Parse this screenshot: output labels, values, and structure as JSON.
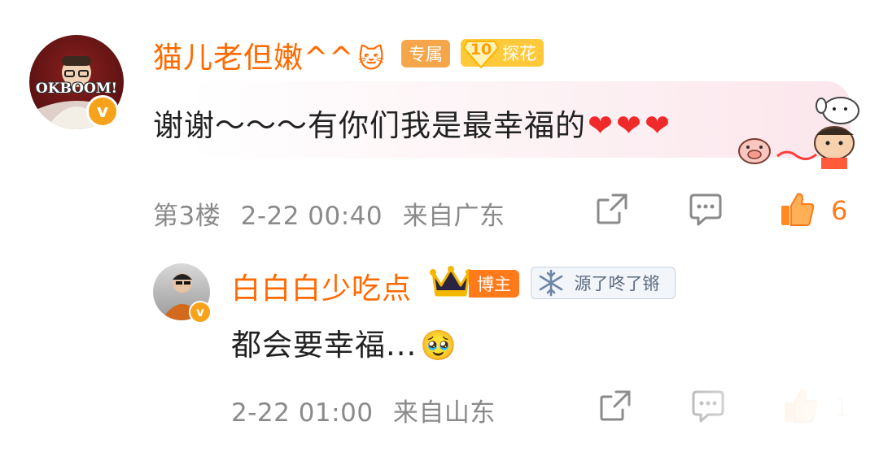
{
  "comment1": {
    "username": "猫儿老但嫩^^",
    "username_emoji": "🐱",
    "badge_exclusive": "专属",
    "badge_level": "10",
    "badge_tanhua": "探花",
    "text": "谢谢～～～有你们我是最幸福的",
    "hearts": "❤❤❤",
    "floor": "第3楼",
    "time": "2-22 00:40",
    "location": "来自广东",
    "likes": "6",
    "avatar_label": "OKBOOM!"
  },
  "reply": {
    "username": "白白白少吃点",
    "badge_host": "博主",
    "badge_fans": "源了咚了锵",
    "text": "都会要幸福...",
    "text_emoji": "🥹",
    "time": "2-22 01:00",
    "location": "来自山东",
    "likes": "1"
  },
  "icons": {
    "share": "share-icon",
    "comment": "comment-icon",
    "like": "thumbs-up-icon",
    "verified": "verified-v-icon",
    "crown": "crown-icon",
    "snowflake": "snowflake-icon"
  },
  "colors": {
    "username": "#ff6a00",
    "meta": "#8a8a8a",
    "like": "#ff7a1a",
    "heart": "#f02a2a",
    "verified": "#f7a21b"
  }
}
